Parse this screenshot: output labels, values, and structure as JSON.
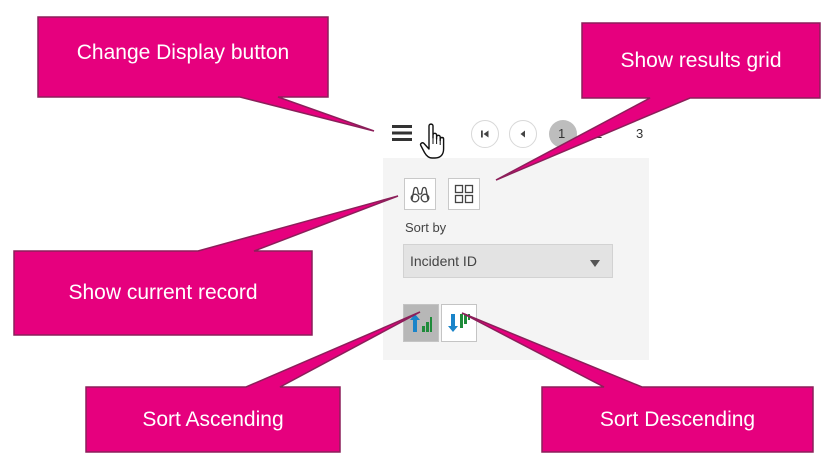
{
  "colors": {
    "callout_fill": "#e6007e",
    "callout_stroke": "#8c1f5a",
    "callout_text": "#ffffff",
    "panel_bg": "#f4f4f4",
    "sort_ascending_bg": "#b7b7b7",
    "arrow_up": "#1a84c9",
    "arrow_down": "#1a84c9",
    "bars_green": "#1f8b3a"
  },
  "callouts": {
    "change_display": "Change Display button",
    "show_results_grid": "Show results grid",
    "show_current_record": "Show current record",
    "sort_ascending": "Sort Ascending",
    "sort_descending": "Sort Descending"
  },
  "toolbar": {
    "menu_icon": "hamburger-menu-icon",
    "cursor_icon": "hand-pointer-icon",
    "first_page_icon": "first-page-icon",
    "prev_page_icon": "previous-page-icon",
    "current_page": "1",
    "pages": [
      "2",
      "3"
    ]
  },
  "views": {
    "record_icon": "binoculars-icon",
    "grid_icon": "grid-icon"
  },
  "sort": {
    "label": "Sort by",
    "selected": "Incident ID",
    "ascending_icon": "sort-ascending-icon",
    "descending_icon": "sort-descending-icon"
  }
}
